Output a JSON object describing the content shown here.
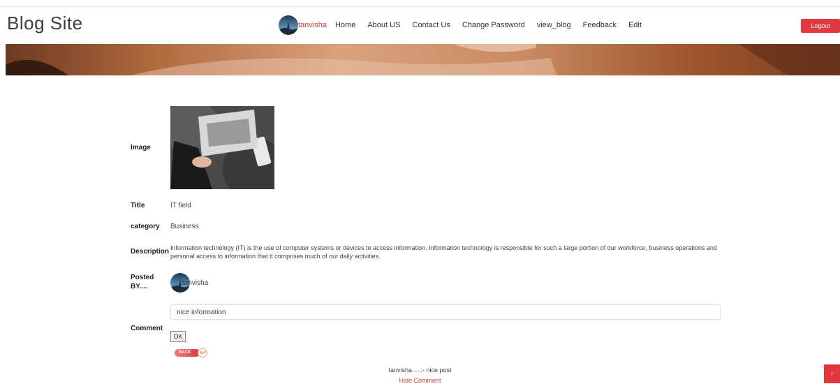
{
  "header": {
    "brand": "Blog Site",
    "user_name": "tanvisha",
    "nav": [
      "Home",
      "About US",
      "Contact Us",
      "Change Password",
      "view_blog",
      "Feedback",
      "Edit"
    ],
    "logout_label": "Logout"
  },
  "blog": {
    "image_label": "Image",
    "title_label": "Title",
    "title_value": "IT field",
    "category_label": "category",
    "category_value": "Business",
    "description_label": "Description",
    "description_value": "Information technology (IT) is the use of computer systems or devices to access information. Information technology is responsible for such a large portion of our workforce, business operations and personal access to information that it comprises much of our daily activities.",
    "posted_by_label_1": "Posted",
    "posted_by_label_2": "BY....",
    "posted_by_value": "tanvisha",
    "comment_label": "Comment",
    "comment_value": "nice information",
    "ok_label": "OK",
    "back_label": "BACK"
  },
  "comments": {
    "entry": "tanvisha ....:- nice post",
    "toggle_label": "Hide Comment"
  },
  "colors": {
    "accent": "#e0383e",
    "text": "#444444"
  },
  "icons": {
    "scroll_top": "arrow-up-icon",
    "back": "back-arrow-icon"
  }
}
